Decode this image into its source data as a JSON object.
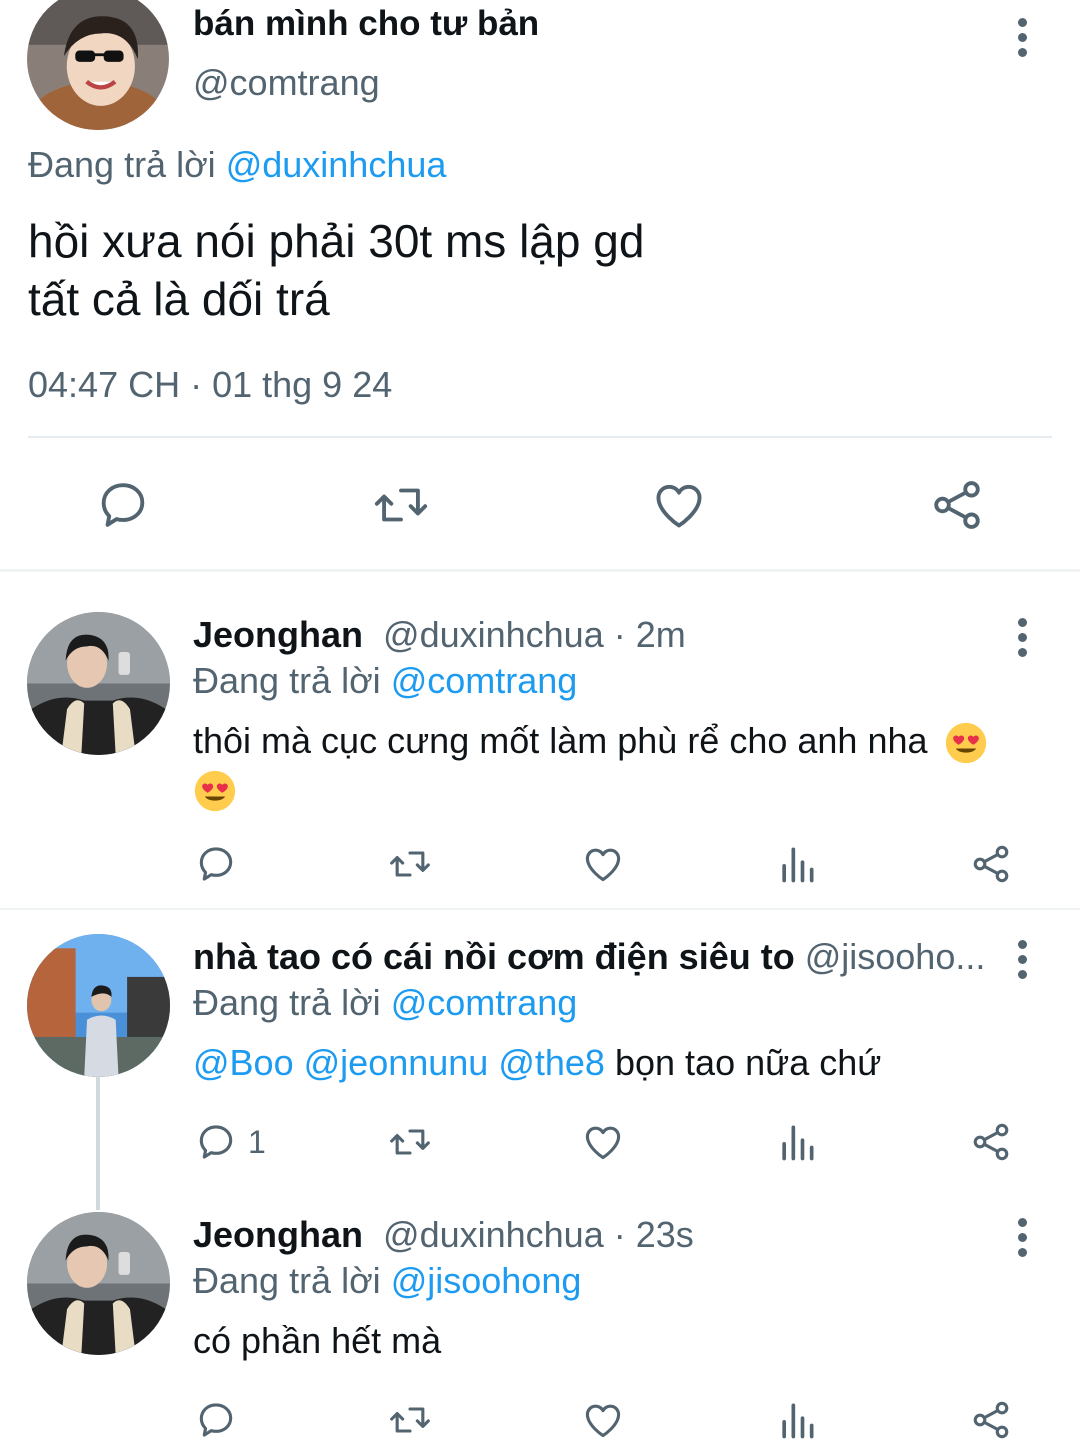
{
  "main_tweet": {
    "name": "bán mình cho tư bản",
    "handle": "@comtrang",
    "replying_label": "Đang trả lời ",
    "replying_to": "@duxinhchua",
    "text_line1": "hồi xưa nói phải 30t ms lập gd",
    "text_line2": "tất cả là dối trá",
    "timestamp": "04:47 CH · 01 thg 9 24"
  },
  "replies": [
    {
      "name": "Jeonghan",
      "meta": "@duxinhchua · 2m",
      "replying_label": "Đang trả lời ",
      "replying_to": "@comtrang",
      "text": "thôi mà cục cưng mốt làm phù rể cho anh nha",
      "reply_count": ""
    },
    {
      "name": "nhà tao có cái nồi cơm điện siêu to",
      "meta": "@jisooho...",
      "replying_label": "Đang trả lời ",
      "replying_to": "@comtrang",
      "mentions": [
        "@Boo",
        "@jeonnunu",
        "@the8"
      ],
      "text": "bọn tao nữa chứ",
      "reply_count": "1"
    },
    {
      "name": "Jeonghan",
      "meta": "@duxinhchua · 23s",
      "replying_label": "Đang trả lời ",
      "replying_to": "@jisoohong",
      "text": "có phần hết mà",
      "reply_count": ""
    }
  ],
  "icons": {
    "reply": "speech-bubble-icon",
    "retweet": "retweet-icon",
    "like": "heart-icon",
    "views": "bar-chart-icon",
    "share": "share-icon",
    "more": "vertical-ellipsis-icon"
  },
  "colors": {
    "accent": "#1d9bf0",
    "secondary_text": "#536471",
    "primary_text": "#0f1419"
  }
}
